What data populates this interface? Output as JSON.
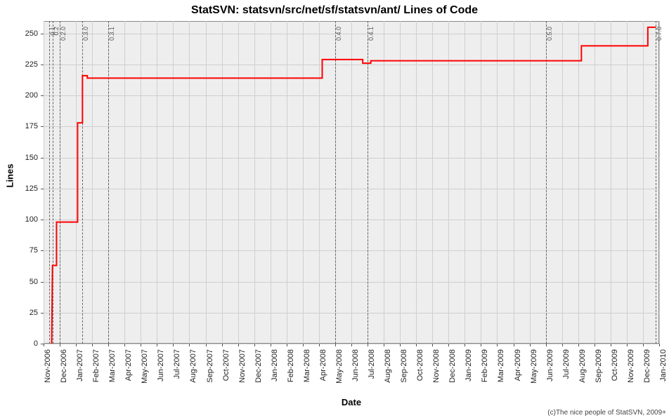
{
  "title": "StatSVN: statsvn/src/net/sf/statsvn/ant/ Lines of Code",
  "xlabel": "Date",
  "ylabel": "Lines",
  "footer": "(c)The nice people of StatSVN, 2009+",
  "chart_data": {
    "type": "line",
    "title": "StatSVN: statsvn/src/net/sf/statsvn/ant/ Lines of Code",
    "xlabel": "Date",
    "ylabel": "Lines",
    "ylim": [
      0,
      260
    ],
    "xlim": [
      "Nov-2006",
      "Jan-2010"
    ],
    "y_ticks": [
      0,
      25,
      50,
      75,
      100,
      125,
      150,
      175,
      200,
      225,
      250
    ],
    "x_ticks": [
      "Nov-2006",
      "Dec-2006",
      "Jan-2007",
      "Feb-2007",
      "Mar-2007",
      "Apr-2007",
      "May-2007",
      "Jun-2007",
      "Jul-2007",
      "Aug-2007",
      "Sep-2007",
      "Oct-2007",
      "Nov-2007",
      "Dec-2007",
      "Jan-2008",
      "Feb-2008",
      "Mar-2008",
      "Apr-2008",
      "May-2008",
      "Jun-2008",
      "Jul-2008",
      "Aug-2008",
      "Sep-2008",
      "Oct-2008",
      "Nov-2008",
      "Dec-2008",
      "Jan-2009",
      "Feb-2009",
      "Mar-2009",
      "Apr-2009",
      "May-2009",
      "Jun-2009",
      "Jul-2009",
      "Aug-2009",
      "Sep-2009",
      "Oct-2009",
      "Nov-2009",
      "Dec-2009",
      "Jan-2010"
    ],
    "markers": [
      {
        "label": "0.1",
        "month_index": 0.35
      },
      {
        "label": "0.2",
        "month_index": 0.55
      },
      {
        "label": "0.2.0",
        "month_index": 1.0
      },
      {
        "label": "0.3.0",
        "month_index": 2.4
      },
      {
        "label": "0.3.1",
        "month_index": 4.0
      },
      {
        "label": "0.4.0",
        "month_index": 18.0
      },
      {
        "label": "0.4.1",
        "month_index": 20.0
      },
      {
        "label": "0.5.0",
        "month_index": 31.0
      },
      {
        "label": "0.7.0",
        "month_index": 37.8
      }
    ],
    "series": [
      {
        "name": "Lines of Code",
        "color": "#ff0000",
        "points": [
          {
            "x": 0.5,
            "y": 0
          },
          {
            "x": 0.55,
            "y": 63
          },
          {
            "x": 0.8,
            "y": 63
          },
          {
            "x": 0.8,
            "y": 98
          },
          {
            "x": 2.1,
            "y": 98
          },
          {
            "x": 2.1,
            "y": 178
          },
          {
            "x": 2.4,
            "y": 178
          },
          {
            "x": 2.4,
            "y": 216
          },
          {
            "x": 2.7,
            "y": 216
          },
          {
            "x": 2.7,
            "y": 214
          },
          {
            "x": 17.2,
            "y": 214
          },
          {
            "x": 17.2,
            "y": 229
          },
          {
            "x": 19.7,
            "y": 229
          },
          {
            "x": 19.7,
            "y": 226
          },
          {
            "x": 20.2,
            "y": 226
          },
          {
            "x": 20.2,
            "y": 228
          },
          {
            "x": 33.2,
            "y": 228
          },
          {
            "x": 33.2,
            "y": 240
          },
          {
            "x": 37.3,
            "y": 240
          },
          {
            "x": 37.3,
            "y": 255
          },
          {
            "x": 37.8,
            "y": 255
          }
        ]
      }
    ]
  }
}
